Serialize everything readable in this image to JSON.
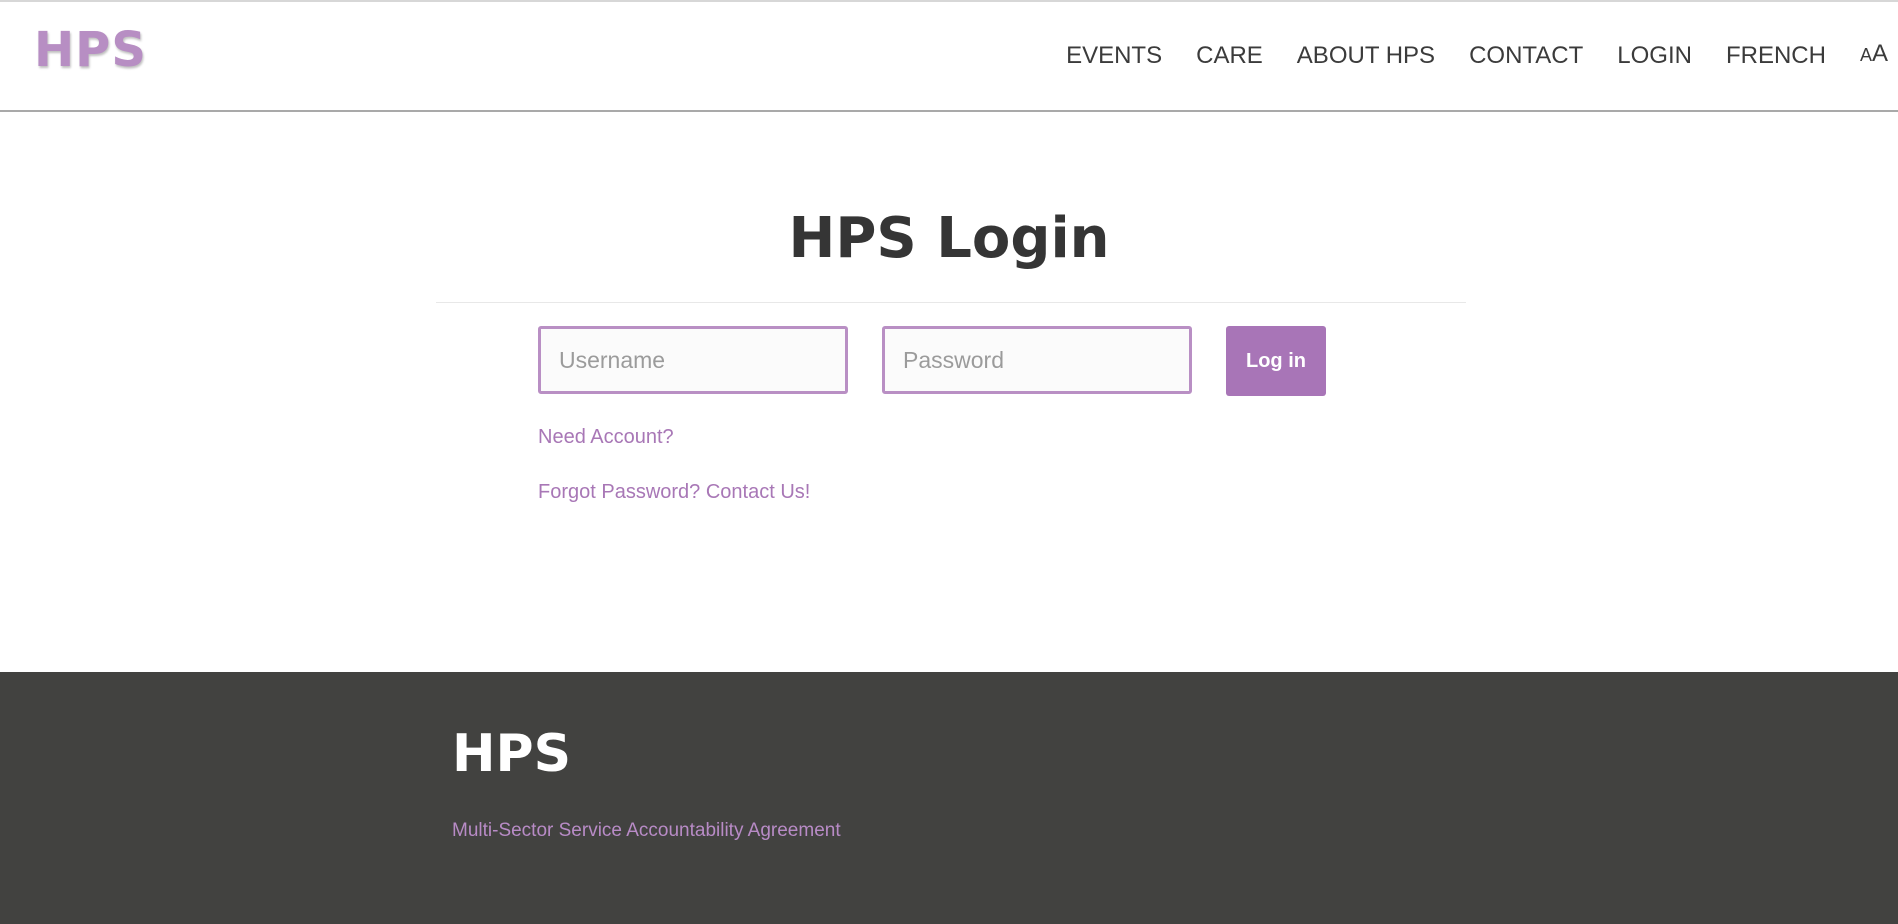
{
  "header": {
    "logo": "HPS",
    "nav": [
      {
        "label": "EVENTS"
      },
      {
        "label": "CARE"
      },
      {
        "label": "ABOUT HPS"
      },
      {
        "label": "CONTACT"
      },
      {
        "label": "LOGIN"
      },
      {
        "label": "FRENCH"
      }
    ],
    "font_size_toggle": {
      "small": "A",
      "big": "A"
    }
  },
  "main": {
    "title": "HPS Login",
    "username_placeholder": "Username",
    "password_placeholder": "Password",
    "login_button": "Log in",
    "need_account": "Need Account?",
    "forgot_password": "Forgot Password? Contact Us!"
  },
  "footer": {
    "title": "HPS",
    "link": "Multi-Sector Service Accountability Agreement"
  },
  "colors": {
    "accent": "#a875b7",
    "logo": "#b78ec3",
    "footer_bg": "#424240",
    "text_dark": "#353535"
  }
}
